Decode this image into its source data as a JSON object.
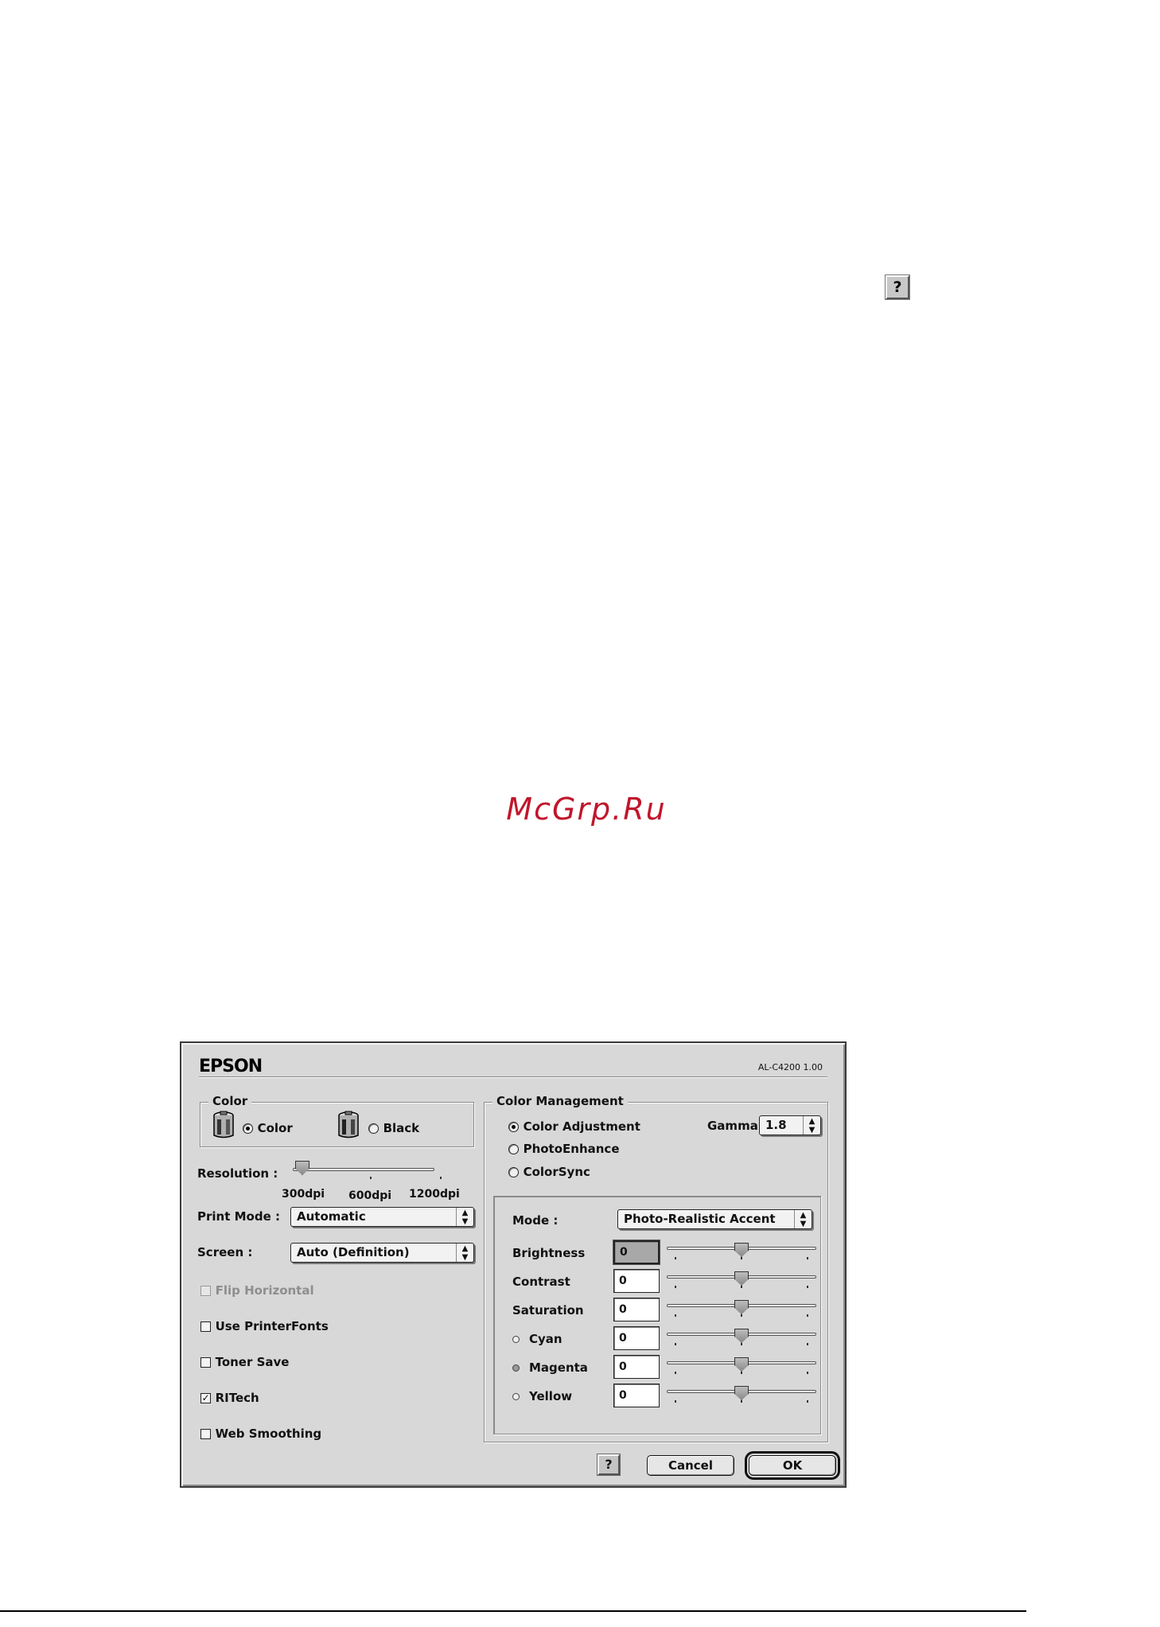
{
  "page": {
    "help_icon": "?",
    "watermark": "McGrp.Ru"
  },
  "dialog": {
    "brand": "EPSON",
    "model": "AL-C4200 1.00",
    "color_group": {
      "title": "Color",
      "options": [
        {
          "label": "Color",
          "selected": true,
          "icon": "color-cartridge-icon"
        },
        {
          "label": "Black",
          "selected": false,
          "icon": "black-cartridge-icon"
        }
      ]
    },
    "resolution": {
      "label": "Resolution :",
      "ticks": [
        "300dpi",
        "600dpi",
        "1200dpi"
      ],
      "value": "300dpi"
    },
    "print_mode": {
      "label": "Print Mode :",
      "value": "Automatic"
    },
    "screen": {
      "label": "Screen :",
      "value": "Auto (Definition)"
    },
    "checkboxes": [
      {
        "label": "Flip Horizontal",
        "checked": false,
        "disabled": true
      },
      {
        "label": "Use PrinterFonts",
        "checked": false,
        "disabled": false
      },
      {
        "label": "Toner Save",
        "checked": false,
        "disabled": false
      },
      {
        "label": "RITech",
        "checked": true,
        "disabled": false
      },
      {
        "label": "Web Smoothing",
        "checked": false,
        "disabled": false
      }
    ],
    "color_management": {
      "title": "Color Management",
      "options": [
        {
          "label": "Color Adjustment",
          "selected": true
        },
        {
          "label": "PhotoEnhance",
          "selected": false
        },
        {
          "label": "ColorSync",
          "selected": false
        }
      ],
      "gamma": {
        "label": "Gamma",
        "value": "1.8"
      },
      "mode": {
        "label": "Mode :",
        "value": "Photo-Realistic Accent"
      },
      "adjustments": [
        {
          "label": "Brightness",
          "value": "0",
          "radio": null,
          "level": 0.5
        },
        {
          "label": "Contrast",
          "value": "0",
          "radio": null,
          "level": 0.5
        },
        {
          "label": "Saturation",
          "value": "0",
          "radio": null,
          "level": 0.5
        },
        {
          "label": "Cyan",
          "value": "0",
          "radio": "off",
          "level": 0.5
        },
        {
          "label": "Magenta",
          "value": "0",
          "radio": "on",
          "level": 0.5
        },
        {
          "label": "Yellow",
          "value": "0",
          "radio": "off",
          "level": 0.5
        }
      ]
    },
    "buttons": {
      "help": "?",
      "cancel": "Cancel",
      "ok": "OK"
    }
  }
}
